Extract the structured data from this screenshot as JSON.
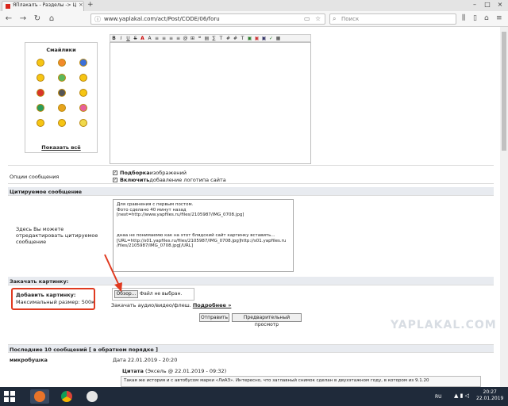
{
  "browser": {
    "tab_title": "ЯПлакалъ - Разделы -> Цити...",
    "tab_close": "×",
    "new_tab": "+",
    "url": "www.yaplakal.com/act/Post/CODE/06/foru",
    "search_placeholder": "Поиск",
    "window_controls": [
      "–",
      "□",
      "×"
    ]
  },
  "smileys": {
    "title": "Смайлики",
    "show_all": "Показать всё"
  },
  "editor": {
    "toolbar": [
      "B",
      "I",
      "U",
      "S",
      "A",
      "A",
      "≡",
      "≡",
      "≡",
      "≡",
      "@",
      "⊞",
      "❝",
      "▤",
      "∑",
      "T",
      "#",
      "#",
      "T",
      "▣",
      "▣",
      "▣",
      "✓",
      "▦"
    ]
  },
  "options": {
    "label": "Опции сообщения",
    "opt1_bold": "Подборка",
    "opt1_rest": " изображений",
    "opt2_bold": "Включить",
    "opt2_rest": " добавление логотипа сайта"
  },
  "quote": {
    "section_title": "Цитируемое сообщение",
    "hint": "Здесь Вы можете отредактировать цитируемое сообщение",
    "lines": [
      "Для сравнения с первым постом.",
      "Фото сделано 40 минут назад",
      "[next=http://www.yapfiles.ru/files/2105987/IMG_0708.jpg]",
      "",
      "",
      "",
      "днаа не понимаемю как на этот блядский сайт картинку вставить...",
      "[URL=http://s01.yapfiles.ru/files/2105987/IMG_0708.jpg]http://s01.yapfiles.ru",
      "/files/2105987/IMG_0708.jpg[/URL]"
    ]
  },
  "upload": {
    "section_title": "Закачать картинку:",
    "add_label": "Добавить картинку:",
    "max_size": "Максимальный размер: 500к",
    "browse_button": "Обзор...",
    "no_file": "Файл не выбран.",
    "media_text": "Закачать аудио/видео/флеш.",
    "more_link": "Подробнее »"
  },
  "actions": {
    "submit": "Отправить",
    "preview": "Предварительный просмотр"
  },
  "recent": {
    "title": "Последние 10 сообщений [ в обратном порядке ]",
    "author": "микробушка",
    "date": "Дата 22.01.2019 - 20:20",
    "quote_header": "Цитата",
    "quote_meta": " (Эксель @ 22.01.2019 - 09:32)",
    "quote_text": "Такая же история и с автобусом марки «ЛиАЗ». Интересно, что заглавный снимок сделан в двухэтажном году, в котором из 9.1.20"
  },
  "watermark": "YAPLAKAL.COM",
  "taskbar": {
    "lang": "RU",
    "time": "20:27",
    "date": "22.01.2019"
  },
  "colors": {
    "highlight": "#e03a20",
    "section_bg": "#e8ebf0",
    "taskbar": "#1f2a3a"
  }
}
